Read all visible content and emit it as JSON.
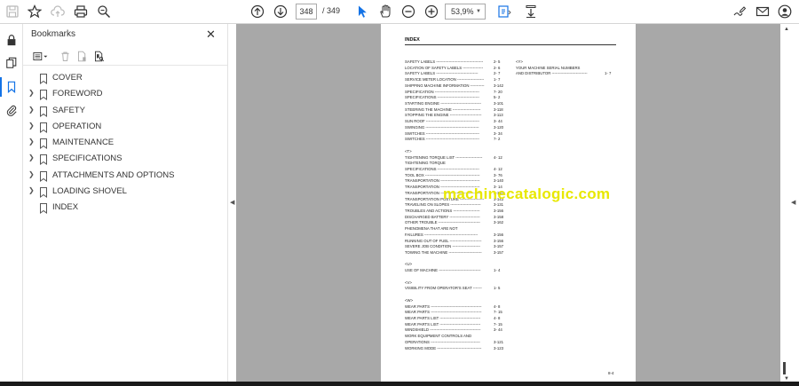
{
  "toolbar": {
    "page_current": "348",
    "page_total": "/ 349",
    "zoom": "53,9%"
  },
  "bookmarks": {
    "title": "Bookmarks",
    "items": [
      {
        "label": "COVER",
        "expandable": false
      },
      {
        "label": "FOREWORD",
        "expandable": true
      },
      {
        "label": "SAFETY",
        "expandable": true
      },
      {
        "label": "OPERATION",
        "expandable": true
      },
      {
        "label": "MAINTENANCE",
        "expandable": true
      },
      {
        "label": "SPECIFICATIONS",
        "expandable": true
      },
      {
        "label": "ATTACHMENTS AND OPTIONS",
        "expandable": true
      },
      {
        "label": "LOADING SHOVEL",
        "expandable": true
      },
      {
        "label": "INDEX",
        "expandable": false
      }
    ]
  },
  "document": {
    "title": "INDEX",
    "page_number": "8-4",
    "watermark": "machinecatalogic.com",
    "left_column": [
      {
        "text": "SAFETY LABELS -------------------------------------",
        "num": "2-  5"
      },
      {
        "text": "   LOCATION OF SAFETY LABELS ----------------",
        "num": "2-  6"
      },
      {
        "text": "   SAFETY LABELS ---------------------------------",
        "num": "2-  7"
      },
      {
        "text": "SERVICE METER LOCATION ---------------------",
        "num": "1-  7"
      },
      {
        "text": "SHIPPING MACHINE INFORMATION -----------",
        "num": "3-142"
      },
      {
        "text": "SPECIFICATION -----------------------------------",
        "num": "7- 20"
      },
      {
        "text": "SPECIFICATIONS ---------------------------------",
        "num": "5-  2"
      },
      {
        "text": "STARTING ENGINE --------------------------------",
        "num": "3-101"
      },
      {
        "text": "STEERING THE MACHINE ----------------------",
        "num": "3-118"
      },
      {
        "text": "STOPPING THE ENGINE -------------------------",
        "num": "3-113"
      },
      {
        "text": "SUN ROOF ------------------------------------------",
        "num": "3- 44"
      },
      {
        "text": "SWINGING ------------------------------------------",
        "num": "3-120"
      },
      {
        "text": "SWITCHES ------------------------------------------",
        "num": "3- 34"
      },
      {
        "text": "SWITCHES ------------------------------------------",
        "num": "7-  2"
      },
      {
        "text": "",
        "num": ""
      },
      {
        "text": "<T>",
        "num": ""
      },
      {
        "text": "TIGHTENING TORQUE LIST ---------------------",
        "num": "4- 12"
      },
      {
        "text": "TIGHTENING TORQUE",
        "num": ""
      },
      {
        "text": "SPECIFICATIONS ---------------------------------",
        "num": "4- 12"
      },
      {
        "text": "TOOL BOX -------------------------------------------",
        "num": "3- 76"
      },
      {
        "text": "TRANSPORTATION -------------------------------",
        "num": "3-140"
      },
      {
        "text": "TRANSPORTATION -------------------------------",
        "num": "3- 14"
      },
      {
        "text": "TRANSPORTATION -------------------------------",
        "num": "3-140"
      },
      {
        "text": "TRANSPORTATION POSTURE -------------------",
        "num": "3-143"
      },
      {
        "text": "TRAVELING ON SLOPES ------------------------",
        "num": "3-131"
      },
      {
        "text": "TROUBLES AND ACTIONS ---------------------",
        "num": "3-156"
      },
      {
        "text": "   DISCHARGED BATTERY ------------------------",
        "num": "3-158"
      },
      {
        "text": "   OTHER TROUBLE ---------------------------------",
        "num": "3-162"
      },
      {
        "text": "   PHENOMENA THAT ARE NOT",
        "num": ""
      },
      {
        "text": "   FAILURES ------------------------------------------",
        "num": "3-156"
      },
      {
        "text": "   RUNNING OUT OF FUEL -------------------------",
        "num": "3-156"
      },
      {
        "text": "   SEVERE JOB CONDITION ----------------------",
        "num": "3-157"
      },
      {
        "text": "   TOWING THE MACHINE --------------------------",
        "num": "3-157"
      },
      {
        "text": "",
        "num": ""
      },
      {
        "text": "<U>",
        "num": ""
      },
      {
        "text": "USE OF MACHINE ---------------------------------",
        "num": "1-  4"
      },
      {
        "text": "",
        "num": ""
      },
      {
        "text": "<V>",
        "num": ""
      },
      {
        "text": "VISIBILITY FROM OPERATOR'S SEAT -------",
        "num": "1-  5"
      },
      {
        "text": "",
        "num": ""
      },
      {
        "text": "<W>",
        "num": ""
      },
      {
        "text": "WEAR PARTS ----------------------------------------",
        "num": "4-  8"
      },
      {
        "text": "WEAR PARTS ----------------------------------------",
        "num": "7- 15"
      },
      {
        "text": "WEAR PARTS LIST --------------------------------",
        "num": "4-  8"
      },
      {
        "text": "WEAR PARTS LIST --------------------------------",
        "num": "7- 15"
      },
      {
        "text": "WINDSHIELD ----------------------------------------",
        "num": "3- 44"
      },
      {
        "text": "WORK EQUIPMENT CONTROLS AND",
        "num": ""
      },
      {
        "text": "OPERATIONS ---------------------------------------",
        "num": "3-121"
      },
      {
        "text": "WORKING MODE -----------------------------------",
        "num": "3-123"
      }
    ],
    "right_column": [
      {
        "text": "<Y>",
        "num": ""
      },
      {
        "text": "YOUR MACHINE SERIAL NUMBERS",
        "num": ""
      },
      {
        "text": "AND DISTRIBUTOR ----------------------------",
        "num": "1-  7"
      }
    ]
  }
}
